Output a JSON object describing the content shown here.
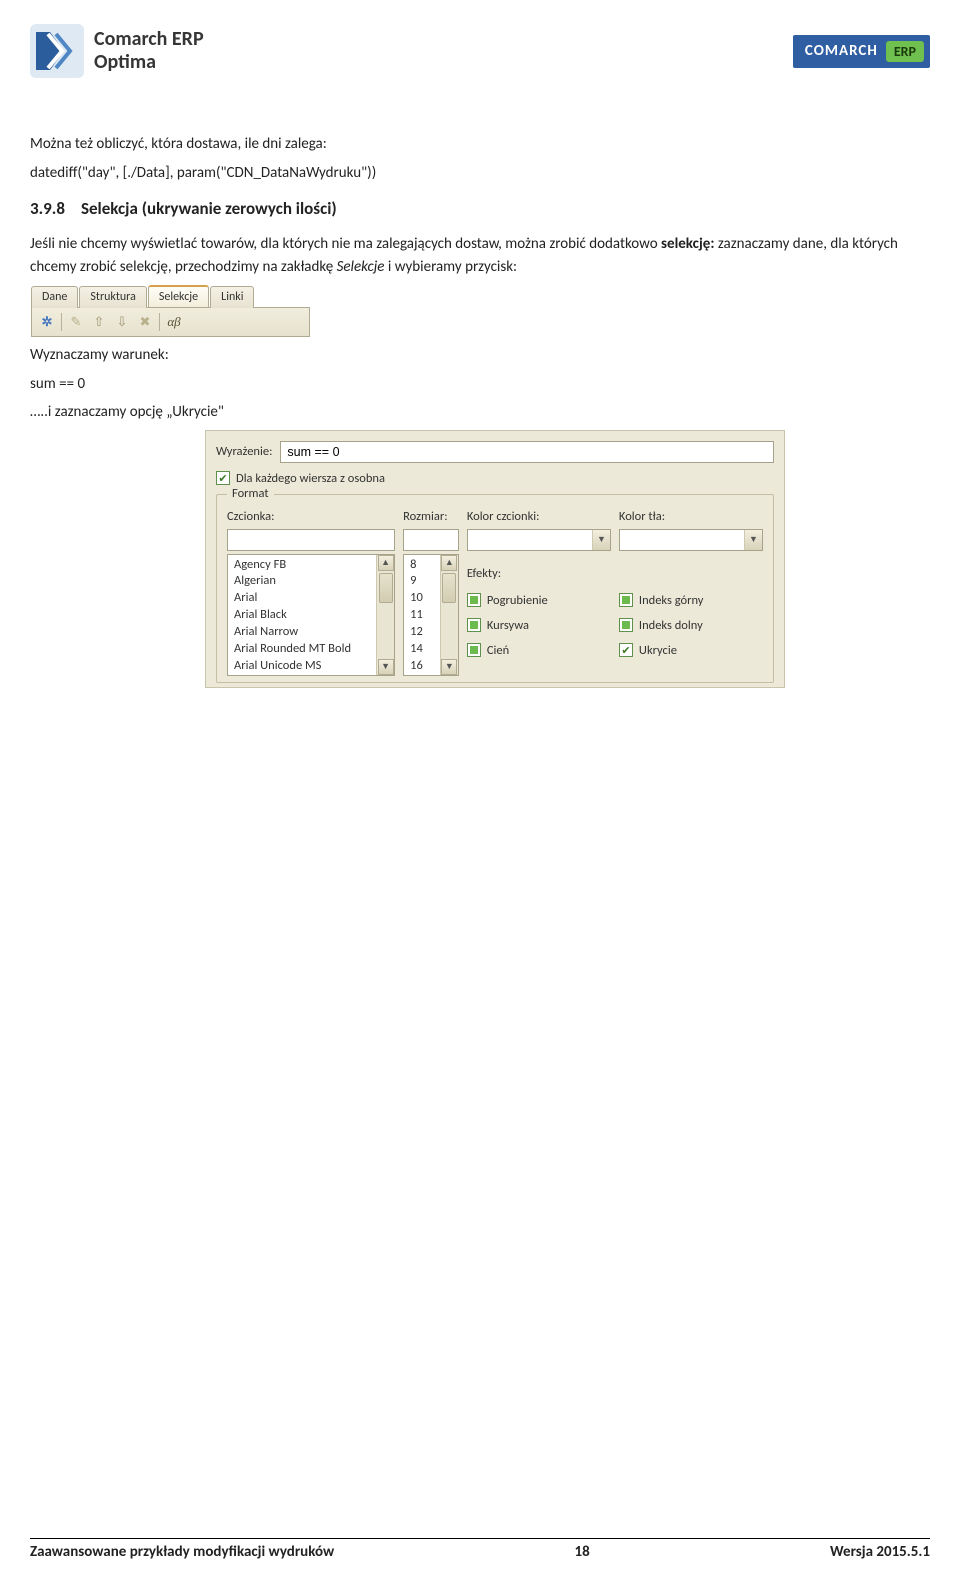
{
  "header": {
    "brand_line1": "Comarch ERP",
    "brand_line2": "Optima",
    "badge_comarch": "COMARCH",
    "badge_erp": "ERP"
  },
  "body": {
    "p1": "Można też obliczyć, która dostawa, ile dni zalega:",
    "p2": "datediff(\"day\", [./Data], param(\"CDN_DataNaWydruku\"))",
    "sec_num": "3.9.8",
    "sec_title": "Selekcja (ukrywanie zerowych ilości)",
    "p3a": "Jeśli nie chcemy wyświetlać towarów, dla których nie ma zalegających dostaw, można zrobić dodatkowo ",
    "p3b": "selekcję:",
    "p3c": " zaznaczamy dane, dla których chcemy zrobić selekcję, przechodzimy na zakładkę ",
    "p3d": "Selekcje",
    "p3e": " i wybieramy przycisk:",
    "tabs": {
      "t1": "Dane",
      "t2": "Struktura",
      "t3": "Selekcje",
      "t4": "Linki"
    },
    "toolbar_ab": "αβ",
    "p4": "Wyznaczamy warunek:",
    "p5": "sum == 0",
    "p6": "…..i zaznaczamy opcję „Ukrycie\""
  },
  "dialog": {
    "expr_label": "Wyrażenie:",
    "expr_value": "sum == 0",
    "per_row": "Dla każdego wiersza z osobna",
    "format": "Format",
    "font_label": "Czcionka:",
    "size_label": "Rozmiar:",
    "kcz_label": "Kolor czcionki:",
    "kt_label": "Kolor tła:",
    "fonts": [
      "Agency FB",
      "Algerian",
      "Arial",
      "Arial Black",
      "Arial Narrow",
      "Arial Rounded MT Bold",
      "Arial Unicode MS"
    ],
    "sizes": [
      "8",
      "9",
      "10",
      "11",
      "12",
      "14",
      "16"
    ],
    "effects_label": "Efekty:",
    "eff": {
      "bold": "Pogrubienie",
      "italic": "Kursywa",
      "shadow": "Cień",
      "sup": "Indeks górny",
      "sub": "Indeks dolny",
      "hide": "Ukrycie"
    }
  },
  "footer": {
    "left": "Zaawansowane przykłady modyfikacji wydruków",
    "center": "18",
    "right": "Wersja 2015.5.1"
  }
}
